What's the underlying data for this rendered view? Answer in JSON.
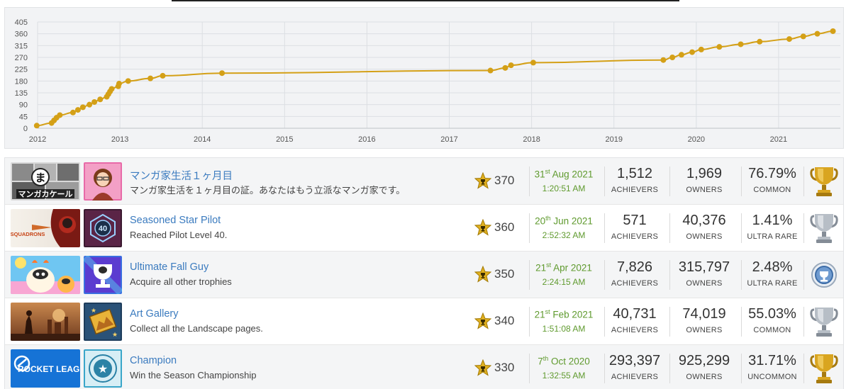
{
  "chart_data": {
    "type": "line",
    "title": "",
    "xlabel": "",
    "ylabel": "",
    "xlim": [
      2012,
      2021.75
    ],
    "ylim": [
      0,
      405
    ],
    "y_ticks": [
      "0",
      "45",
      "90",
      "135",
      "180",
      "225",
      "270",
      "315",
      "360",
      "405"
    ],
    "x_ticks": [
      "2012",
      "2013",
      "2014",
      "2015",
      "2016",
      "2017",
      "2018",
      "2019",
      "2020",
      "2021"
    ],
    "grid": true,
    "color": "#d4a017",
    "series": [
      {
        "name": "",
        "points": [
          [
            2011.99,
            10
          ],
          [
            2012.17,
            20
          ],
          [
            2012.2,
            30
          ],
          [
            2012.23,
            40
          ],
          [
            2012.27,
            50
          ],
          [
            2012.43,
            60
          ],
          [
            2012.49,
            70
          ],
          [
            2012.55,
            80
          ],
          [
            2012.63,
            90
          ],
          [
            2012.69,
            100
          ],
          [
            2012.76,
            110
          ],
          [
            2012.84,
            120
          ],
          [
            2012.86,
            130
          ],
          [
            2012.88,
            140
          ],
          [
            2012.9,
            150
          ],
          [
            2012.98,
            160
          ],
          [
            2012.99,
            170
          ],
          [
            2013.1,
            180
          ],
          [
            2013.37,
            190
          ],
          [
            2013.52,
            200
          ],
          [
            2014.24,
            210
          ],
          [
            2017.5,
            220
          ],
          [
            2017.68,
            230
          ],
          [
            2017.75,
            240
          ],
          [
            2018.02,
            250
          ],
          [
            2019.6,
            260
          ],
          [
            2019.71,
            270
          ],
          [
            2019.82,
            280
          ],
          [
            2019.95,
            290
          ],
          [
            2020.06,
            300
          ],
          [
            2020.28,
            310
          ],
          [
            2020.54,
            320
          ],
          [
            2020.77,
            330
          ],
          [
            2021.13,
            340
          ],
          [
            2021.3,
            350
          ],
          [
            2021.47,
            360
          ],
          [
            2021.66,
            370
          ]
        ]
      }
    ]
  },
  "trophies": [
    {
      "name": "マンガ家生活１ヶ月目",
      "description": "マンガ家生活を１ヶ月目の証。あなたはもう立派なマンガ家です。",
      "points": "370",
      "day": "31",
      "suffix": "st",
      "month_year": "Aug 2021",
      "time": "1:20:51 AM",
      "achievers": "1,512",
      "achievers_label": "ACHIEVERS",
      "owners": "1,969",
      "owners_label": "OWNERS",
      "rarity": "76.79%",
      "rarity_label": "COMMON",
      "grade": "gold",
      "game_image": "manga-kakeru",
      "game_text": "マンガカケール"
    },
    {
      "name": "Seasoned Star Pilot",
      "description": "Reached Pilot Level 40.",
      "points": "360",
      "day": "20",
      "suffix": "th",
      "month_year": "Jun 2021",
      "time": "2:52:32 AM",
      "achievers": "571",
      "achievers_label": "ACHIEVERS",
      "owners": "40,376",
      "owners_label": "OWNERS",
      "rarity": "1.41%",
      "rarity_label": "ULTRA RARE",
      "grade": "silver",
      "game_image": "star-wars-squadrons",
      "game_text": "SQUADRONS",
      "badge_text": "40"
    },
    {
      "name": "Ultimate Fall Guy",
      "description": "Acquire all other trophies",
      "points": "350",
      "day": "21",
      "suffix": "st",
      "month_year": "Apr 2021",
      "time": "2:24:15 AM",
      "achievers": "7,826",
      "achievers_label": "ACHIEVERS",
      "owners": "315,797",
      "owners_label": "OWNERS",
      "rarity": "2.48%",
      "rarity_label": "ULTRA RARE",
      "grade": "platinum",
      "game_image": "fall-guys"
    },
    {
      "name": "Art Gallery",
      "description": "Collect all the Landscape pages.",
      "points": "340",
      "day": "21",
      "suffix": "st",
      "month_year": "Feb 2021",
      "time": "1:51:08 AM",
      "achievers": "40,731",
      "achievers_label": "ACHIEVERS",
      "owners": "74,019",
      "owners_label": "OWNERS",
      "rarity": "55.03%",
      "rarity_label": "COMMON",
      "grade": "silver",
      "game_image": "landscape-game"
    },
    {
      "name": "Champion",
      "description": "Win the Season Championship",
      "points": "330",
      "day": "7",
      "suffix": "th",
      "month_year": "Oct 2020",
      "time": "1:32:55 AM",
      "achievers": "293,397",
      "achievers_label": "ACHIEVERS",
      "owners": "925,299",
      "owners_label": "OWNERS",
      "rarity": "31.71%",
      "rarity_label": "UNCOMMON",
      "grade": "gold",
      "game_image": "rocket-league",
      "game_text": "ROCKET LEAGUE"
    }
  ],
  "colors": {
    "link": "#3b7bbf",
    "date": "#5f9a2e",
    "gold": "#d4a017",
    "silver": "#b9bfc6",
    "platinum": "#5b8fc7"
  }
}
